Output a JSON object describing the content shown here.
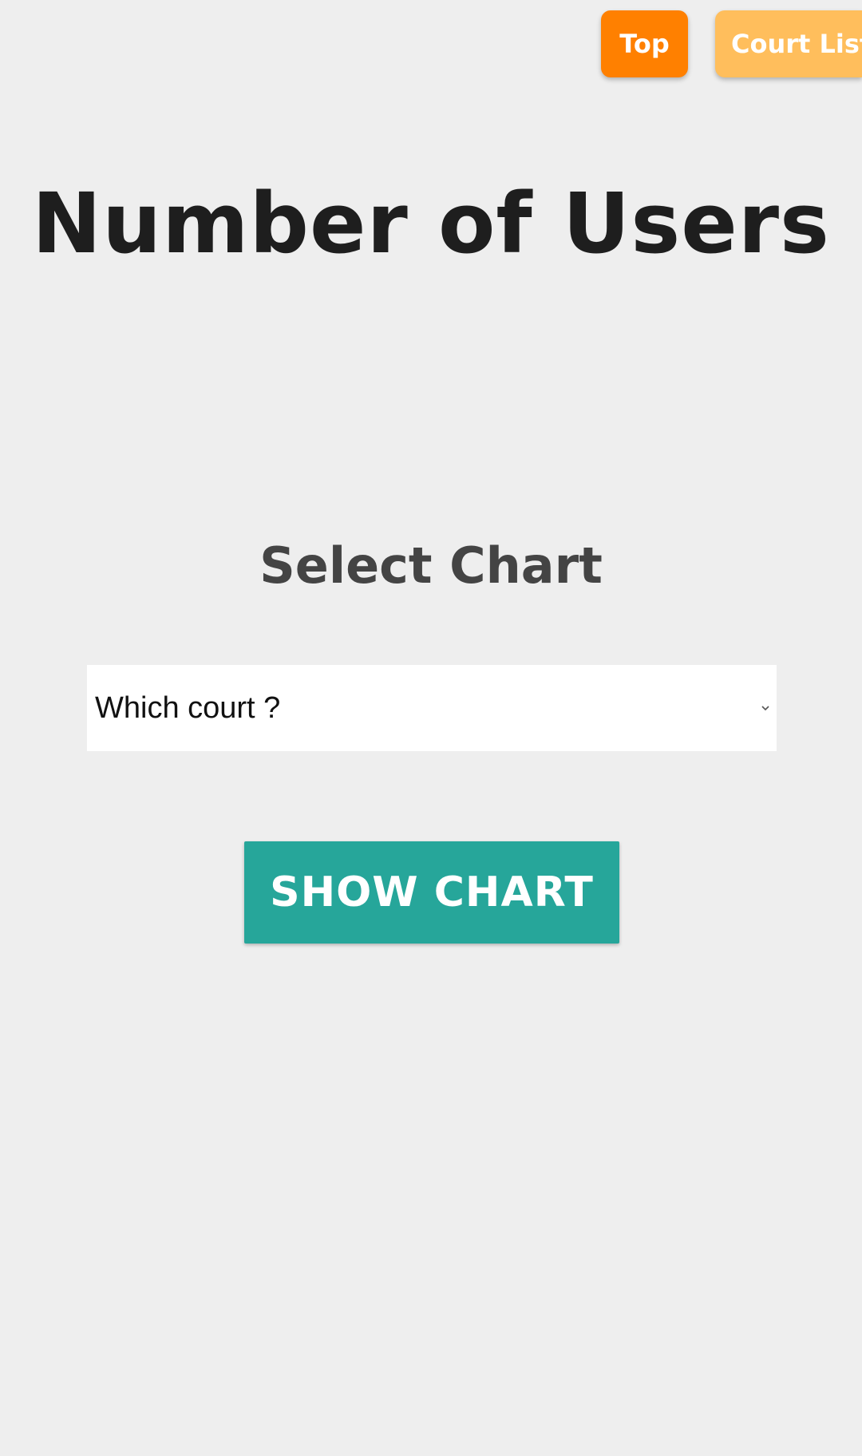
{
  "nav": {
    "top_label": "Top",
    "court_list_label": "Court List"
  },
  "header": {
    "title": "Number of Users"
  },
  "chart_selector": {
    "heading": "Select Chart",
    "court_select_value": "Which court ?",
    "show_button_label": "SHOW CHART"
  },
  "colors": {
    "background": "#eeeeee",
    "top_button": "#ff8000",
    "court_list_button": "#ffbe5c",
    "show_button": "#26a69a"
  },
  "icons": {
    "select_indicator": "chevron-down-icon"
  }
}
